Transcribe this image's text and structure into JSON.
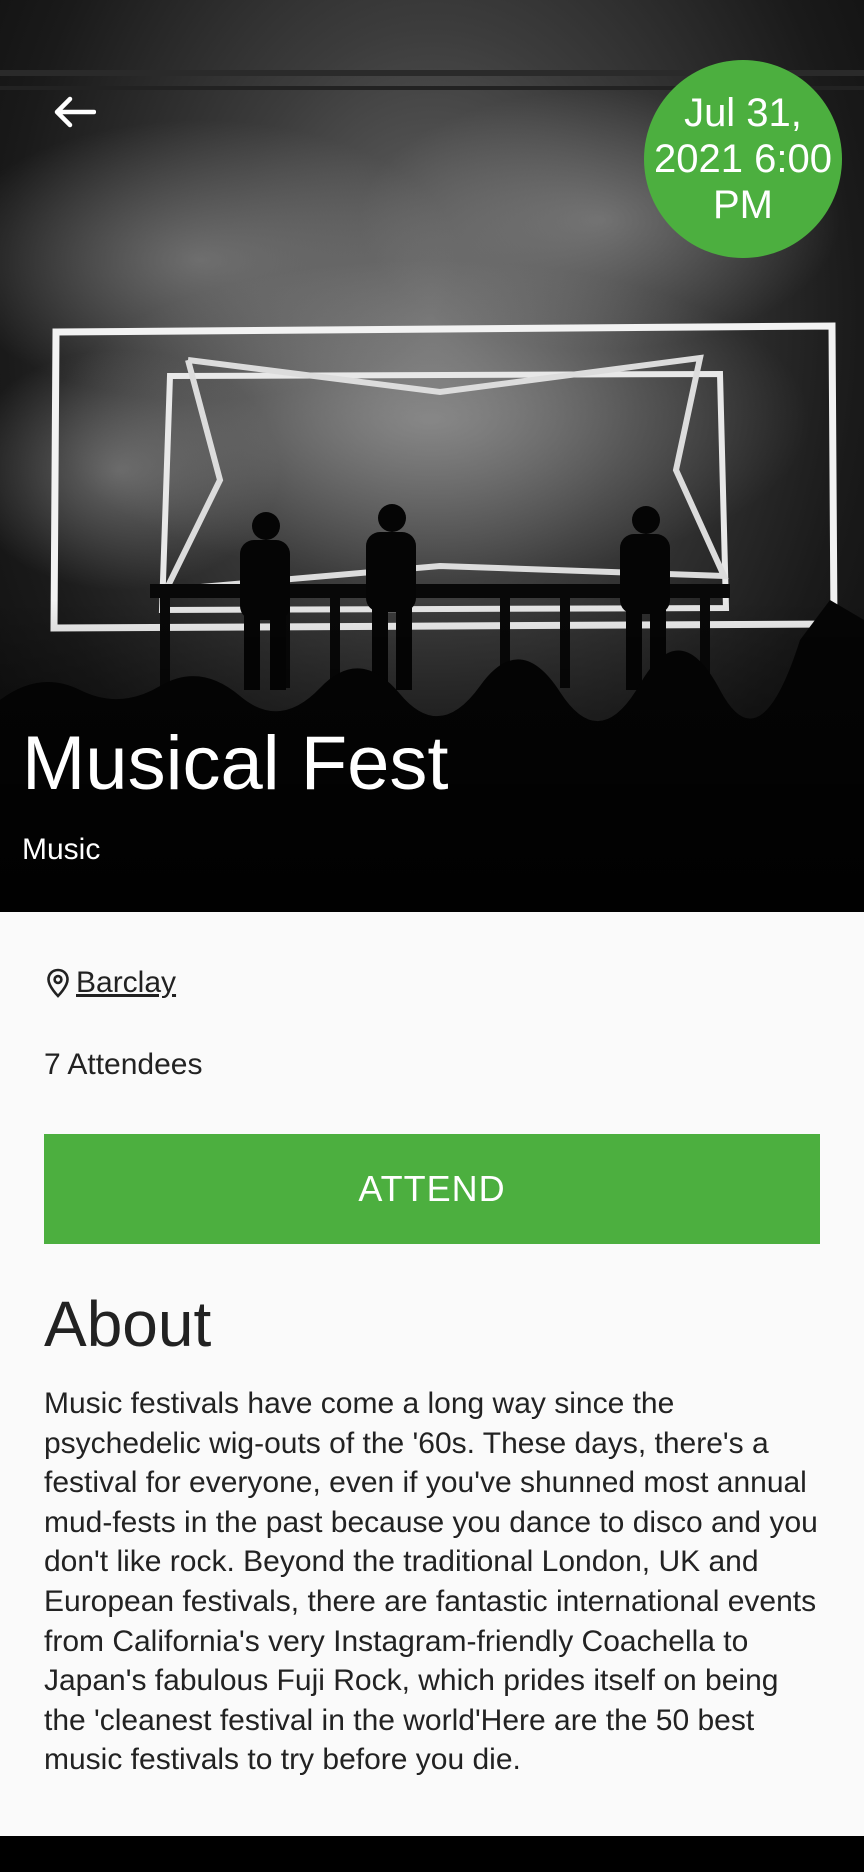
{
  "header": {
    "back_icon": "arrow-left-icon",
    "date_badge": "Jul 31, 2021 6:00 PM"
  },
  "event": {
    "title": "Musical Fest",
    "category": "Music"
  },
  "details": {
    "location_icon": "map-pin-icon",
    "location": "Barclay",
    "attendees": "7 Attendees",
    "attend_label": "ATTEND"
  },
  "about": {
    "heading": "About",
    "text": "Music festivals have come a long way since the psychedelic wig-outs of the '60s. These days, there's a festival for everyone, even if you've shunned most annual mud-fests in the past because you dance to disco and you don't like rock. Beyond the traditional London, UK and European festivals, there are fantastic international events from California's very Instagram-friendly Coachella to Japan's fabulous Fuji Rock, which prides itself on being the 'cleanest festival in the world'Here are the 50 best music festivals to try before you die."
  },
  "colors": {
    "accent": "#4caf3f",
    "background": "#fafafa",
    "text": "#222222"
  }
}
